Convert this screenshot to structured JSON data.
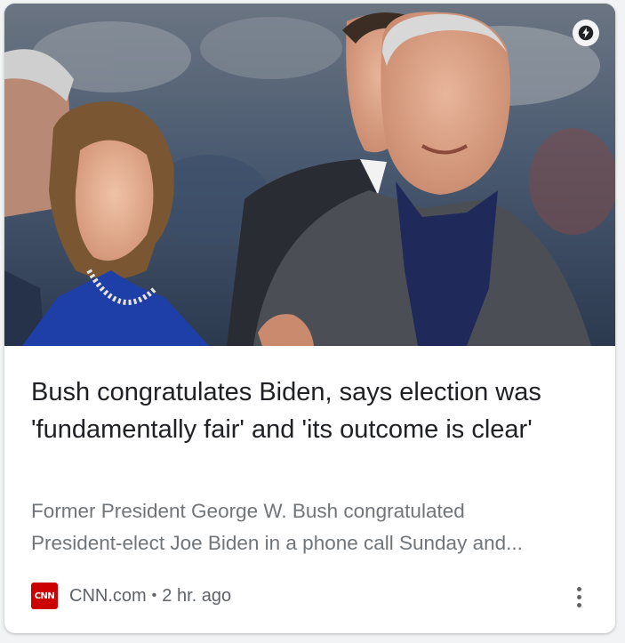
{
  "article": {
    "image_alt": "George W. Bush and Laura Bush smiling at a stadium event",
    "amp_icon": "lightning-bolt-icon",
    "headline": "Bush congratulates Biden, says election was 'fundamentally fair' and 'its outcome is clear'",
    "snippet_line1": "Former President George W. Bush congratulated",
    "snippet_line2": "President-elect Joe Biden in a phone call Sunday and...",
    "source_logo_text": "CNN",
    "source": "CNN.com",
    "separator": "•",
    "time": "2 hr. ago",
    "more_icon": "more-vertical-icon"
  },
  "colors": {
    "headline": "#202124",
    "snippet": "#70757a",
    "meta": "#5f6368",
    "cnn_red": "#cc0000"
  }
}
